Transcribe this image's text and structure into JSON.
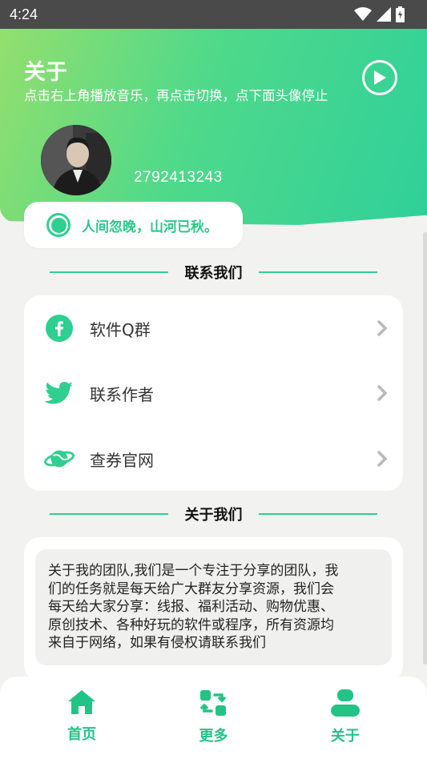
{
  "status_bar": {
    "time": "4:24"
  },
  "header": {
    "title": "关于",
    "subtitle": "点击右上角播放音乐，再点击切换，点下面头像停止",
    "qq_number": "2792413243",
    "motto": "人间忽晚，山河已秋。"
  },
  "contact_section": {
    "title": "联系我们",
    "items": [
      {
        "label": "软件Q群",
        "icon": "facebook-icon"
      },
      {
        "label": "联系作者",
        "icon": "twitter-icon"
      },
      {
        "label": "查券官网",
        "icon": "planet-icon"
      }
    ]
  },
  "about_section": {
    "title": "关于我们",
    "lines": [
      "关于我的团队,我们是一个专注于分享的团队，我",
      "们的任务就是每天给广大群友分享资源，我们会",
      "每天给大家分享：线报、福利活动、购物优惠、",
      "原创技术、各种好玩的软件或程序，所有资源均",
      "来自于网络，如果有侵权请联系我们"
    ]
  },
  "bottom_nav": {
    "items": [
      {
        "label": "首页",
        "icon": "home-icon"
      },
      {
        "label": "更多",
        "icon": "switch-icon"
      },
      {
        "label": "关于",
        "icon": "user-icon"
      }
    ]
  },
  "colors": {
    "accent": "#2fcf8f",
    "gradient_start": "#93df6e",
    "gradient_end": "#2fd09a"
  }
}
